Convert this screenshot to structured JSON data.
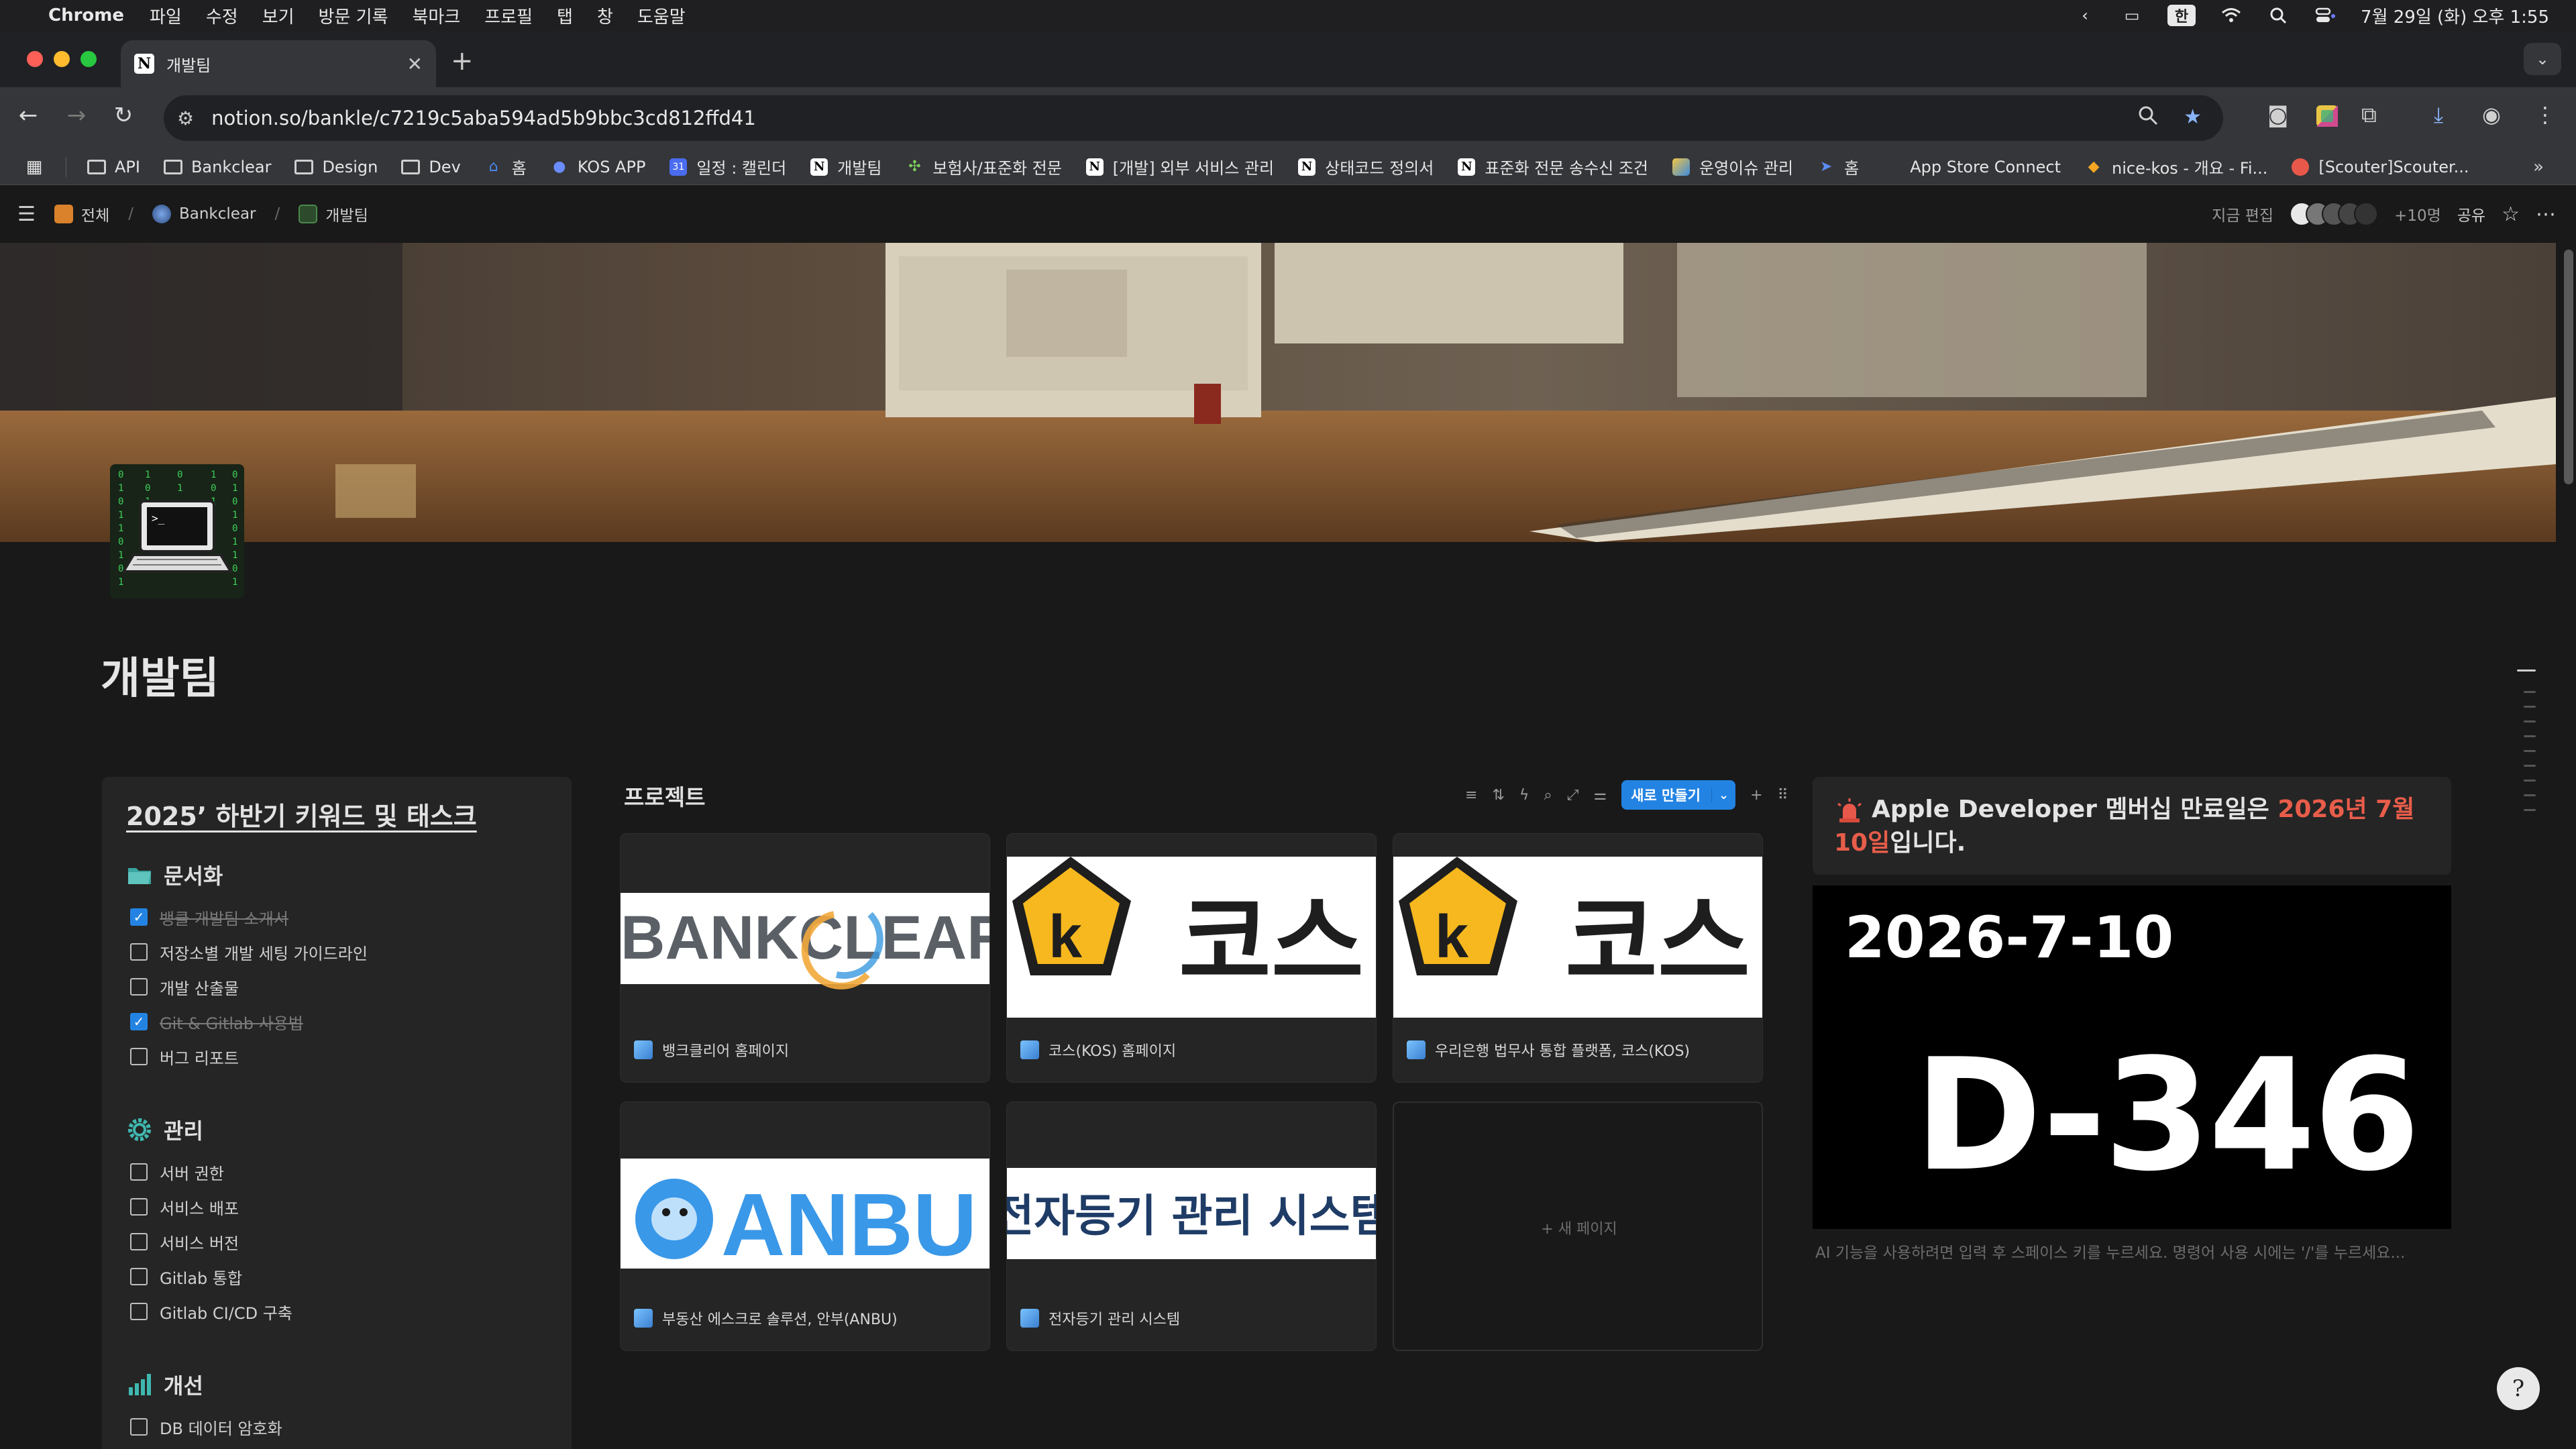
{
  "menubar": {
    "app_name": "Chrome",
    "menus": [
      "파일",
      "수정",
      "보기",
      "방문 기록",
      "북마크",
      "프로필",
      "탭",
      "창",
      "도움말"
    ],
    "ime": "한",
    "datetime": "7월 29일 (화) 오후 1:55"
  },
  "tab": {
    "title": "개발팀"
  },
  "address": {
    "url": "notion.so/bankle/c7219c5aba594ad5b9bbc3cd812ffd41"
  },
  "bookmarks": [
    {
      "label": "API",
      "icon": "folder-icon"
    },
    {
      "label": "Bankclear",
      "icon": "folder-icon"
    },
    {
      "label": "Design",
      "icon": "folder-icon"
    },
    {
      "label": "Dev",
      "icon": "folder-icon"
    },
    {
      "label": "홈",
      "icon": "home-icon"
    },
    {
      "label": "KOS APP",
      "icon": "kos-icon"
    },
    {
      "label": "일정 : 캘린더",
      "icon": "calendar-icon"
    },
    {
      "label": "개발팀",
      "icon": "notion-icon"
    },
    {
      "label": "보험사/표준화 전문",
      "icon": "puzzle-icon"
    },
    {
      "label": "[개발] 외부 서비스 관리",
      "icon": "notion-icon"
    },
    {
      "label": "상태코드 정의서",
      "icon": "notion-icon"
    },
    {
      "label": "표준화 전문 송수신 조건",
      "icon": "notion-icon"
    },
    {
      "label": "운영이슈 관리",
      "icon": "image-icon"
    },
    {
      "label": "홈",
      "icon": "arrow-icon"
    },
    {
      "label": "App Store Connect",
      "icon": "apple-icon"
    },
    {
      "label": "nice-kos - 개요 - Fi...",
      "icon": "firebase-icon"
    },
    {
      "label": "[Scouter]Scouter...",
      "icon": "scouter-icon"
    }
  ],
  "breadcrumb": [
    {
      "label": "전체"
    },
    {
      "label": "Bankclear"
    },
    {
      "label": "개발팀"
    }
  ],
  "topbar": {
    "editing": "지금 편집",
    "more_people": "+10명",
    "share": "공유"
  },
  "page": {
    "title": "개발팀"
  },
  "left": {
    "heading": "2025’ 하반기 키워드 및 태스크",
    "sections": [
      {
        "title": "문서화",
        "items": [
          {
            "text": "뱅클 개발팀 소개서",
            "checked": true
          },
          {
            "text": "저장소별 개발 세팅 가이드라인",
            "checked": false
          },
          {
            "text": "개발 산출물",
            "checked": false
          },
          {
            "text": "Git & Gitlab 사용법",
            "checked": true
          },
          {
            "text": "버그 리포트",
            "checked": false
          }
        ]
      },
      {
        "title": "관리",
        "items": [
          {
            "text": "서버 권한",
            "checked": false
          },
          {
            "text": "서비스 배포",
            "checked": false
          },
          {
            "text": "서비스 버전",
            "checked": false
          },
          {
            "text": "Gitlab 통합",
            "checked": false
          },
          {
            "text": "Gitlab CI/CD 구축",
            "checked": false
          }
        ]
      },
      {
        "title": "개선",
        "items": [
          {
            "text": "DB 데이터 암호화",
            "checked": false
          }
        ]
      }
    ]
  },
  "projects": {
    "title": "프로젝트",
    "new_button": "새로 만들기",
    "cards": [
      {
        "title": "뱅크클리어 홈페이지",
        "logo_text": "BANKCLEAR"
      },
      {
        "title": "코스(KOS) 홈페이지",
        "logo_text": "코스"
      },
      {
        "title": "우리은행 법무사 통합 플랫폼, 코스(KOS)",
        "logo_text": "코스"
      },
      {
        "title": "부동산 에스크로 솔루션, 안부(ANBU)",
        "logo_text": "ANBU"
      },
      {
        "title": "전자등기 관리 시스템",
        "logo_text": "전자등기 관리 시스템"
      }
    ],
    "new_page": "+ 새 페이지"
  },
  "right": {
    "callout_pre": "Apple Developer 멤버십 만료일은 ",
    "callout_date": "2026년 7월 10일",
    "callout_post": "입니다.",
    "dday_date": "2026-7-10",
    "dday_count": "D-346",
    "ai_hint": "AI 기능을 사용하려면 입력 후 스페이스 키를 누르세요. 명령어 사용 시에는 '/'를 누르세요..."
  },
  "colors": {
    "accent": "#2383e2",
    "highlight": "#e85d4a",
    "background": "#191919"
  }
}
